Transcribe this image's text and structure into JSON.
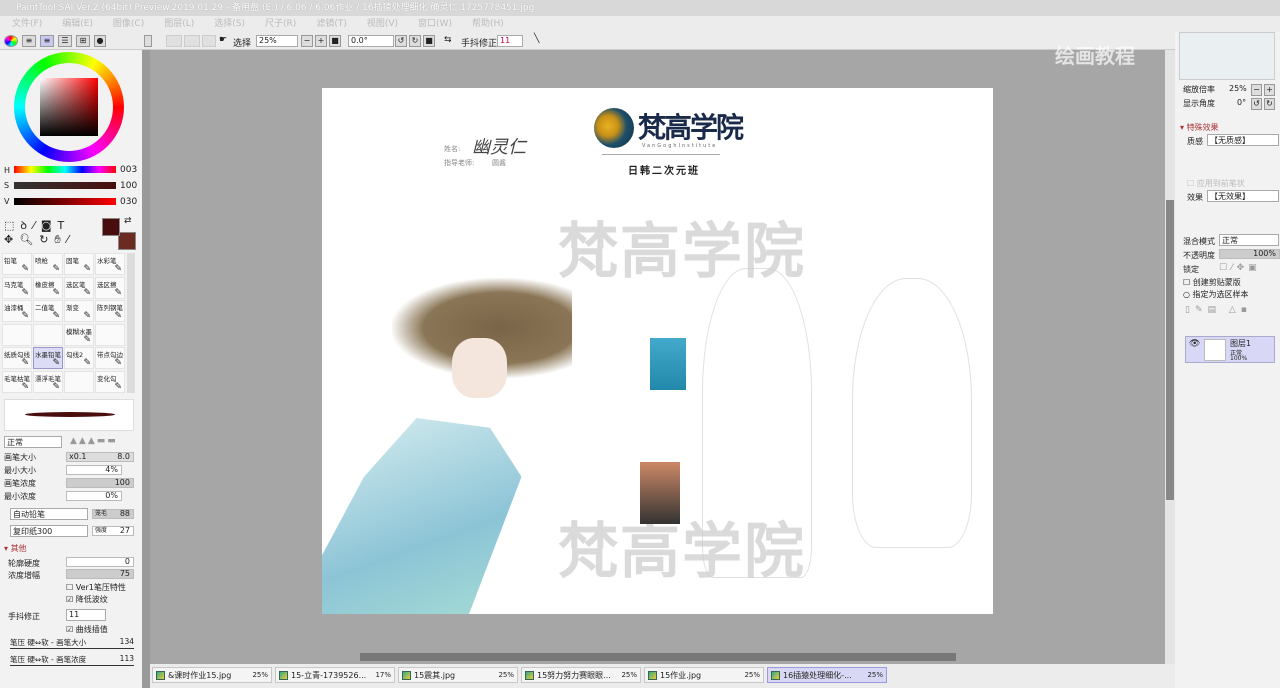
{
  "title": "PaintTool SAI Ver.2 (64bit) Preview.2019.01.29 - 备用盘 (E:) / 6.06 / 6.06作业 / 16插猿处理细化 确灵仁 1725778451.jpg",
  "menu": [
    "文件(F)",
    "编辑(E)",
    "图像(C)",
    "图层(L)",
    "选择(S)",
    "尺子(R)",
    "滤镜(T)",
    "视图(V)",
    "窗口(W)",
    "帮助(H)"
  ],
  "toolbar": {
    "select_label": "选择",
    "zoom": "25%",
    "angle": "0.0°",
    "stabilizer_label": "手抖修正",
    "stabilizer": "11"
  },
  "color": {
    "h_label": "H",
    "h": "003",
    "s_label": "S",
    "s": "100",
    "v_label": "V",
    "v": "030",
    "primary": "#4a0d0d",
    "secondary": "#6b2b22"
  },
  "brushes": [
    [
      "铅笔",
      "喷枪",
      "固笔",
      "水彩笔"
    ],
    [
      "马克笔",
      "橡皮擦",
      "选区笔",
      "选区擦"
    ],
    [
      "油漆桶",
      "二值笔",
      "渐变",
      "陈列钢笔"
    ],
    [
      "",
      "",
      "模糊水墨",
      ""
    ],
    [
      "纸质勾线",
      "水墨铅笔",
      "勾线2",
      "带点勾边"
    ],
    [
      "毛笔枯笔",
      "漂浮毛笔",
      "",
      "变化勾"
    ]
  ],
  "brush_settings": {
    "blend": "正常",
    "size_label": "画笔大小",
    "size_mult": "x0.1",
    "size": "8.0",
    "min_size_label": "最小大小",
    "min_size": "4%",
    "density_label": "画笔浓度",
    "density": "100",
    "min_density_label": "最小浓度",
    "min_density": "0%",
    "shape": "自动铅笔",
    "shape_label": "笼毛",
    "shape_val": "88",
    "texture": "复印纸300",
    "texture_label": "强度",
    "texture_val": "27",
    "other_label": "其他",
    "edge_label": "轮廓硬度",
    "edge": "0",
    "dens_amp_label": "浓度增幅",
    "dens_amp": "75",
    "ver1_label": "Ver1笔压特性",
    "moire_label": "降低波纹",
    "stab_label": "手抖修正",
    "stab": "11",
    "curve_label": "曲线插值",
    "pressure1_label": "笔压 硬⇔软 - 画笔大小",
    "pressure1": "134",
    "pressure2_label": "笔压 硬⇔软 - 画笔浓度",
    "pressure2": "113"
  },
  "navigator": {
    "zoom_label": "缩放倍率",
    "zoom": "25%",
    "angle_label": "显示角度",
    "angle": "0°"
  },
  "effects": {
    "header": "特殊效果",
    "texture_label": "质感",
    "texture": "【无质感】",
    "effect_label": "效果",
    "effect": "【无效果】",
    "apply_label": "应用到前笔状"
  },
  "layer_panel": {
    "blend_label": "混合模式",
    "blend": "正常",
    "opacity_label": "不透明度",
    "opacity": "100%",
    "lock_label": "锁定",
    "clip_label": "创建剪贴蒙版",
    "sample_label": "指定为选区样本",
    "layer_name": "图层1",
    "layer_mode": "正常",
    "layer_opacity": "100%"
  },
  "canvas": {
    "name_label": "姓名:",
    "name": "幽灵仁",
    "teacher_label": "指导老师:",
    "teacher": "圆酱",
    "logo": "梵高学院",
    "logo_sub": "VanGoghInstitute",
    "class_name": "日韩二次元班",
    "watermark": "梵高学院"
  },
  "overlay_watermark": "绘画教程",
  "tabs": [
    {
      "name": "&课时作业15.jpg",
      "pct": "25%"
    },
    {
      "name": "15-立青-1739526...",
      "pct": "17%"
    },
    {
      "name": "15震其.jpg",
      "pct": "25%"
    },
    {
      "name": "15努力努力赛眼眼...",
      "pct": "25%"
    },
    {
      "name": "15作业.jpg",
      "pct": "25%"
    },
    {
      "name": "16插猿处理细化-...",
      "pct": "25%",
      "active": true
    }
  ]
}
